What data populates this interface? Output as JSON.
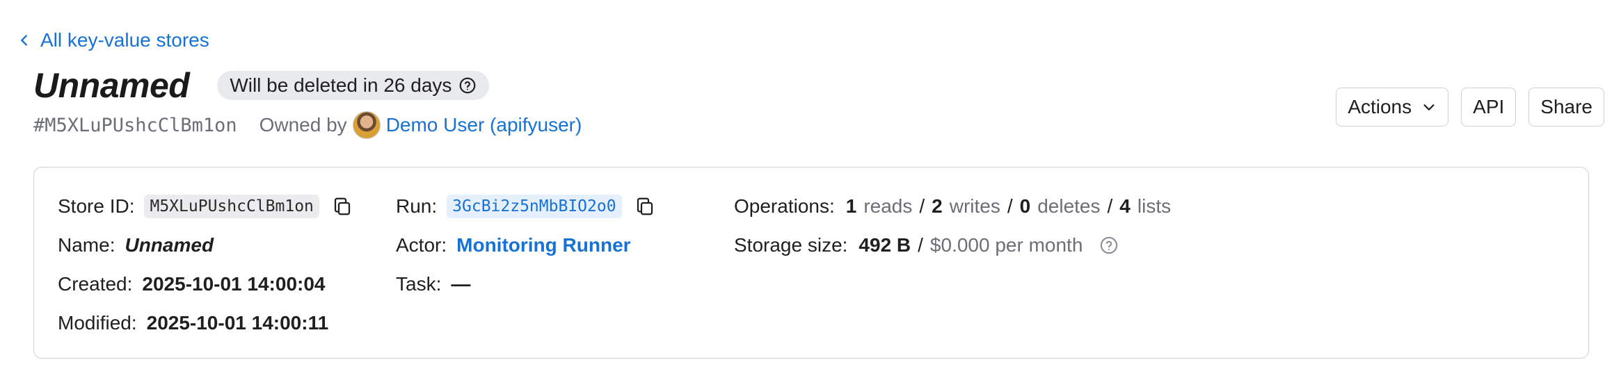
{
  "back_link": {
    "label": "All key-value stores"
  },
  "store": {
    "title": "Unnamed",
    "deletion_notice": "Will be deleted in 26 days",
    "hash_id": "#M5XLuPUshcClBm1on",
    "owned_by_label": "Owned by",
    "owner_name": "Demo User (apifyuser)"
  },
  "toolbar": {
    "actions_label": "Actions",
    "api_label": "API",
    "share_label": "Share"
  },
  "details": {
    "store_id_label": "Store ID:",
    "store_id_value": "M5XLuPUshcClBm1on",
    "name_label": "Name:",
    "name_value": "Unnamed",
    "created_label": "Created:",
    "created_value": "2025-10-01 14:00:04",
    "modified_label": "Modified:",
    "modified_value": "2025-10-01 14:00:11",
    "run_label": "Run:",
    "run_value": "3GcBi2z5nMbBIO2o0",
    "actor_label": "Actor:",
    "actor_value": "Monitoring Runner",
    "task_label": "Task:",
    "task_value": "—",
    "operations_label": "Operations:",
    "operations": {
      "reads_count": "1",
      "reads_label": "reads",
      "writes_count": "2",
      "writes_label": "writes",
      "deletes_count": "0",
      "deletes_label": "deletes",
      "lists_count": "4",
      "lists_label": "lists",
      "separator": "/"
    },
    "storage_label": "Storage size:",
    "storage_value": "492 B",
    "storage_separator": "/",
    "storage_cost": "$0.000 per month"
  },
  "colors": {
    "link": "#1672d4",
    "muted": "#6b6e76",
    "badge_bg": "#e9eaed",
    "border": "#cfd1d6"
  },
  "icons": [
    "chevron-left-icon",
    "help-circle-icon",
    "chevron-down-icon",
    "copy-icon"
  ]
}
